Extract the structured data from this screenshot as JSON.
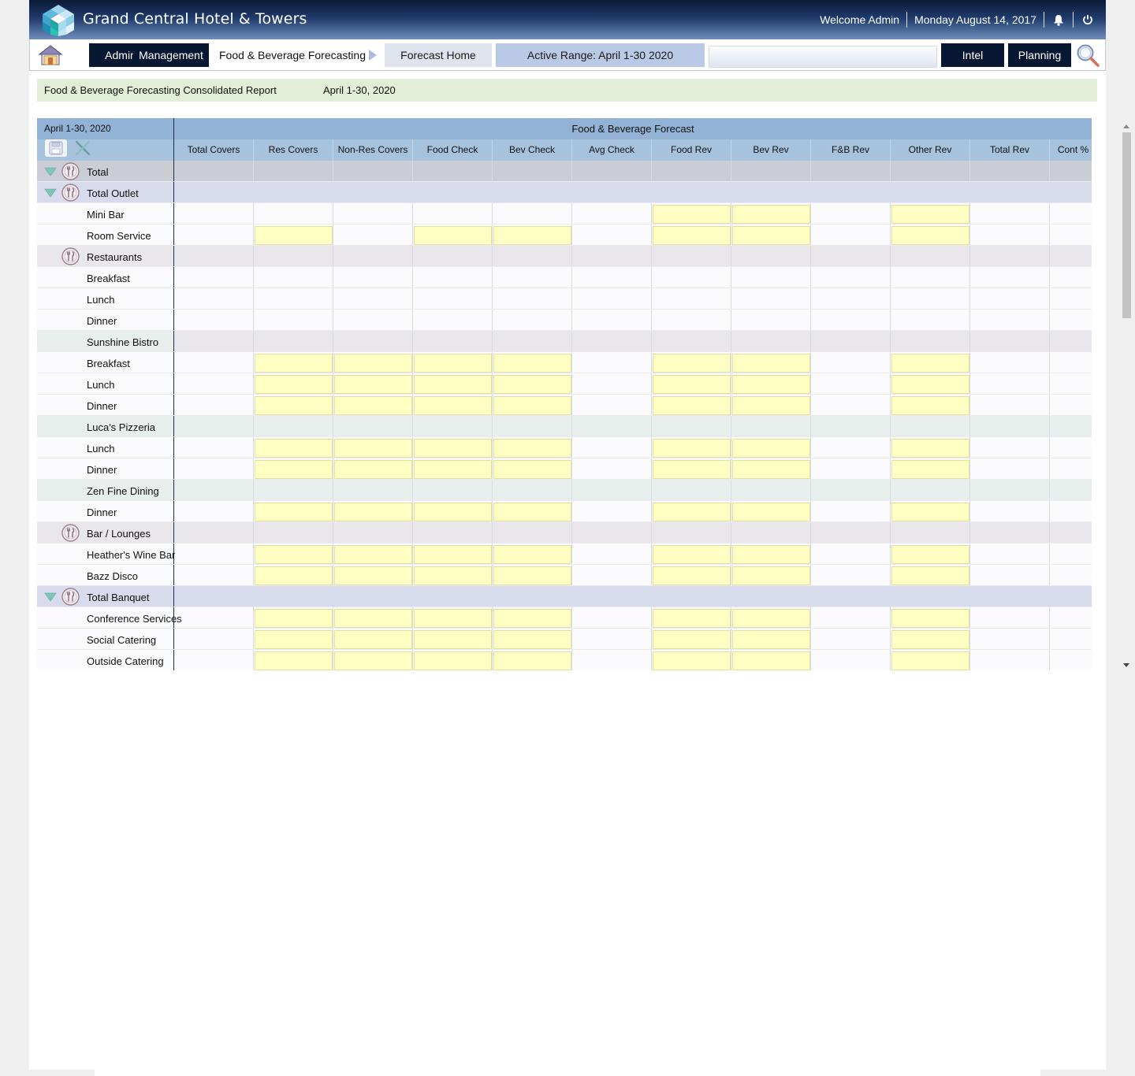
{
  "header": {
    "app_title": "Grand Central Hotel & Towers",
    "welcome": "Welcome Admin",
    "date": "Monday August 14, 2017",
    "icons": [
      "bell-icon",
      "power-icon"
    ]
  },
  "nav": {
    "admin": "Admin",
    "management": "Management",
    "breadcrumb": "Food & Beverage Forecasting",
    "forecast_home": "Forecast Home",
    "active_range": "Active Range: April 1-30 2020",
    "search_value": "",
    "intel": "Intel",
    "planning": "Planning"
  },
  "report": {
    "title": "Food & Beverage Forecasting Consolidated Report",
    "date_range": "April 1-30, 2020"
  },
  "grid": {
    "corner_date": "April 1-30, 2020",
    "group_title": "Food & Beverage Forecast",
    "columns": [
      "Total Covers",
      "Res Covers",
      "Non-Res Covers",
      "Food Check",
      "Bev Check",
      "Avg Check",
      "Food Rev",
      "Bev Rev",
      "F&B Rev",
      "Other Rev",
      "Total Rev",
      "Cont %"
    ],
    "colors": {
      "total": "#cbcdd5",
      "outlet": "#d8dbec",
      "category": "#e9e6ec",
      "venue": "#e8eeec",
      "item": "#fbfbfd",
      "input": "#ffffc3"
    },
    "rows": [
      {
        "label": "Total",
        "kind": "total",
        "expand": true,
        "fork": true,
        "inputs": []
      },
      {
        "label": "Total Outlet",
        "kind": "outlet",
        "expand": true,
        "fork": true,
        "inputs": []
      },
      {
        "label": "Mini Bar",
        "kind": "item",
        "expand": false,
        "fork": false,
        "inputs": [
          6,
          7,
          9
        ]
      },
      {
        "label": "Room Service",
        "kind": "item",
        "expand": false,
        "fork": false,
        "inputs": [
          1,
          3,
          4,
          6,
          7,
          9
        ]
      },
      {
        "label": "Restaurants",
        "kind": "category",
        "expand": false,
        "fork": true,
        "inputs": []
      },
      {
        "label": "Breakfast",
        "kind": "item",
        "expand": false,
        "fork": false,
        "inputs": []
      },
      {
        "label": "Lunch",
        "kind": "item",
        "expand": false,
        "fork": false,
        "inputs": []
      },
      {
        "label": "Dinner",
        "kind": "item",
        "expand": false,
        "fork": false,
        "inputs": []
      },
      {
        "label": "Sunshine Bistro",
        "kind": "venue-alt",
        "expand": false,
        "fork": false,
        "inputs": []
      },
      {
        "label": "Breakfast",
        "kind": "item",
        "expand": false,
        "fork": false,
        "inputs": [
          1,
          2,
          3,
          4,
          6,
          7,
          9
        ]
      },
      {
        "label": "Lunch",
        "kind": "item",
        "expand": false,
        "fork": false,
        "inputs": [
          1,
          2,
          3,
          4,
          6,
          7,
          9
        ]
      },
      {
        "label": "Dinner",
        "kind": "item",
        "expand": false,
        "fork": false,
        "inputs": [
          1,
          2,
          3,
          4,
          6,
          7,
          9
        ]
      },
      {
        "label": "Luca's Pizzeria",
        "kind": "venue",
        "expand": false,
        "fork": false,
        "inputs": []
      },
      {
        "label": "Lunch",
        "kind": "item",
        "expand": false,
        "fork": false,
        "inputs": [
          1,
          2,
          3,
          4,
          6,
          7,
          9
        ]
      },
      {
        "label": "Dinner",
        "kind": "item",
        "expand": false,
        "fork": false,
        "inputs": [
          1,
          2,
          3,
          4,
          6,
          7,
          9
        ]
      },
      {
        "label": "Zen Fine Dining",
        "kind": "venue",
        "expand": false,
        "fork": false,
        "inputs": []
      },
      {
        "label": "Dinner",
        "kind": "item",
        "expand": false,
        "fork": false,
        "inputs": [
          1,
          2,
          3,
          4,
          6,
          7,
          9
        ]
      },
      {
        "label": "Bar / Lounges",
        "kind": "category",
        "expand": false,
        "fork": true,
        "inputs": []
      },
      {
        "label": "Heather's Wine Bar",
        "kind": "item",
        "expand": false,
        "fork": false,
        "inputs": [
          1,
          2,
          3,
          4,
          6,
          7,
          9
        ]
      },
      {
        "label": "Bazz Disco",
        "kind": "item",
        "expand": false,
        "fork": false,
        "inputs": [
          1,
          2,
          3,
          4,
          6,
          7,
          9
        ]
      },
      {
        "label": "Total Banquet",
        "kind": "outlet",
        "expand": true,
        "fork": true,
        "inputs": []
      },
      {
        "label": "Conference Services",
        "kind": "item",
        "expand": false,
        "fork": false,
        "inputs": [
          1,
          2,
          3,
          4,
          6,
          7,
          9
        ]
      },
      {
        "label": "Social Catering",
        "kind": "item",
        "expand": false,
        "fork": false,
        "inputs": [
          1,
          2,
          3,
          4,
          6,
          7,
          9
        ]
      },
      {
        "label": "Outside Catering",
        "kind": "item",
        "expand": false,
        "fork": false,
        "inputs": [
          1,
          2,
          3,
          4,
          6,
          7,
          9
        ]
      }
    ]
  }
}
